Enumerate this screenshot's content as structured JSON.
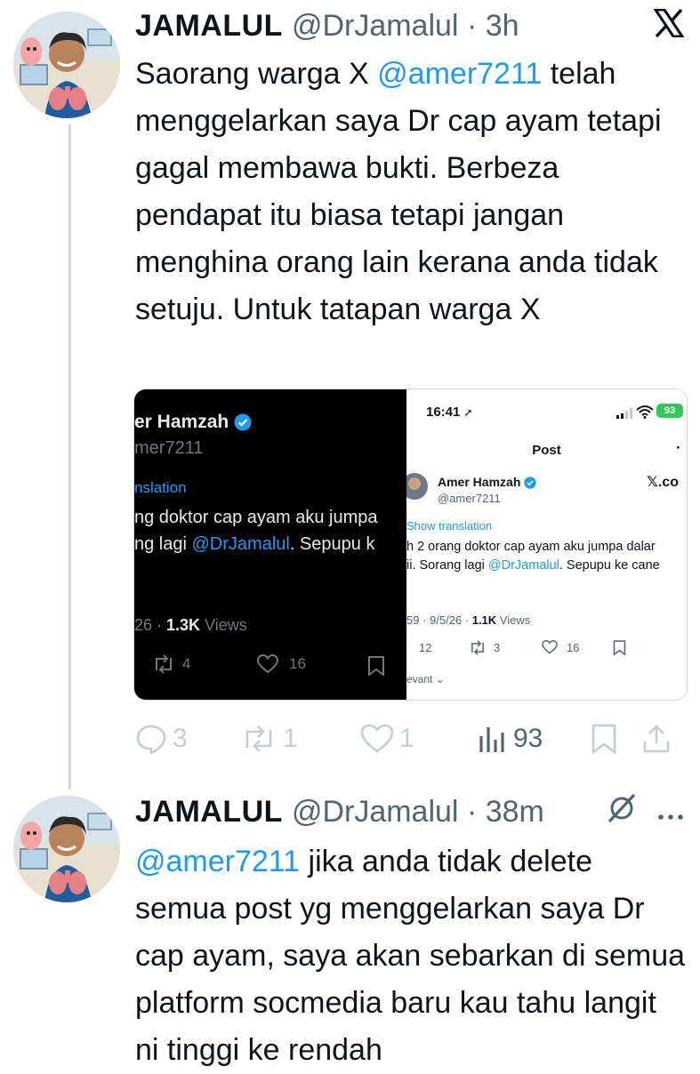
{
  "tweet1": {
    "name": "JAMALUL",
    "handle": "@DrJamalul",
    "time": "3h",
    "body_before": "Saorang warga X ",
    "mention": "@amer7211",
    "body_after": " telah menggelarkan saya Dr cap ayam tetapi gagal membawa bukti. Berbeza pendapat itu biasa tetapi jangan menghina orang lain kerana anda tidak setuju. Untuk tatapan warga X",
    "platform_icon": "x-logo-icon",
    "stats": {
      "replies": "3",
      "reposts": "1",
      "likes": "1",
      "views": "93"
    }
  },
  "media": {
    "left_shot": {
      "name_visible": "er Hamzah",
      "handle_visible": "mer7211",
      "translation": "nslation",
      "line1": "ng doktor cap ayam aku jumpa",
      "line2_before": "ng lagi ",
      "line2_mention": "@DrJamalul",
      "line2_after": ". Sepupu k",
      "date_views_prefix": "26 · ",
      "views_count": "1.3K",
      "views_label": " Views",
      "reposts": "4",
      "likes": "16"
    },
    "right_shot": {
      "status_time": "16:41",
      "battery": "93",
      "header_title": "Post",
      "header_dot": "·",
      "name": "Amer Hamzah",
      "handle": "@amer7211",
      "source": "𝕏.co",
      "translation": "Show translation",
      "line1": "h 2 orang doktor cap ayam aku jumpa dalar",
      "line2_before": "ii. Sorang lagi ",
      "line2_mention": "@DrJamalul",
      "line2_after": ". Sepupu ke cane",
      "date_views_prefix": "59 · 9/5/26 · ",
      "views_count": "1.1K",
      "views_label": " Views",
      "replies": "12",
      "reposts": "3",
      "likes": "16",
      "relevant": "evant"
    }
  },
  "tweet2": {
    "name": "JAMALUL",
    "handle": "@DrJamalul",
    "time": "38m",
    "mention": "@amer7211",
    "body_after": " jika anda tidak delete semua post yg menggelarkan saya Dr cap ayam, saya akan sebarkan di semua platform socmedia baru kau tahu langit ni tinggi ke rendah",
    "platform_icon": "grok-slash-icon",
    "more_icon": "more-dots-icon"
  },
  "colors": {
    "accent": "#1d9bf0",
    "text": "#0f1419",
    "muted": "#536471",
    "action_gray": "#829aab"
  }
}
